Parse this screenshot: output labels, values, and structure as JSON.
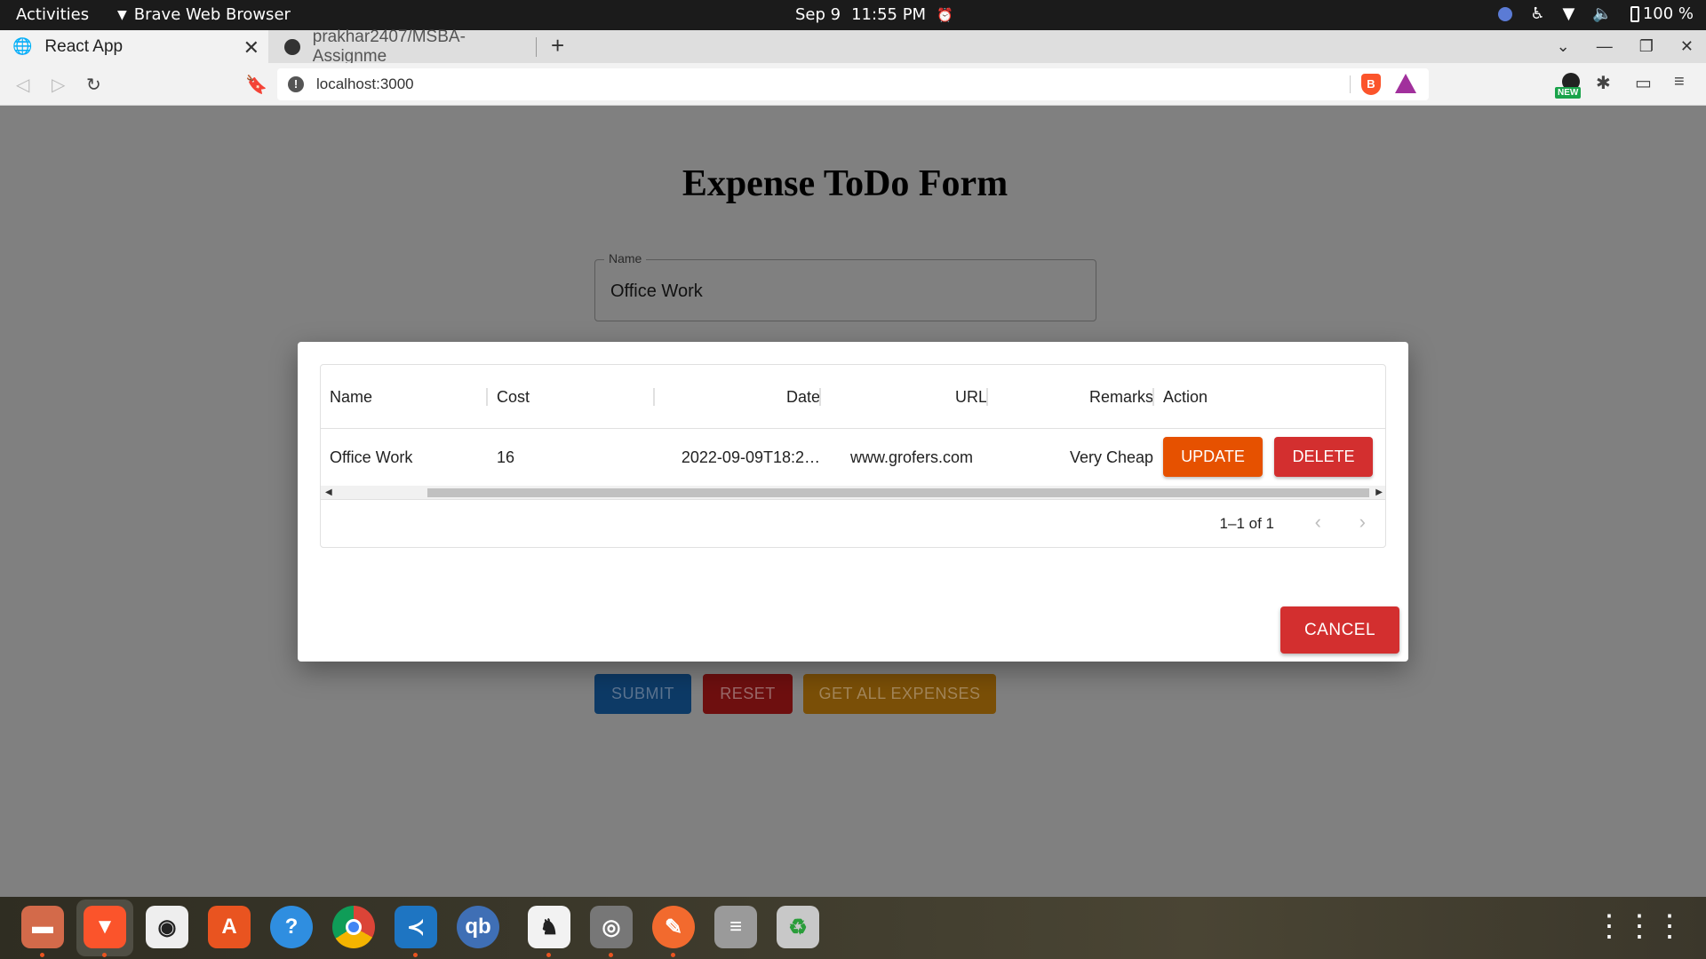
{
  "system_bar": {
    "activities": "Activities",
    "app_name": "Brave Web Browser",
    "date": "Sep 9",
    "time": "11:55 PM",
    "battery": "100 %"
  },
  "browser": {
    "tabs": [
      {
        "title": "React App",
        "active": true
      },
      {
        "title": "prakhar2407/MSBA-Assignme",
        "active": false
      }
    ],
    "url": "localhost:3000",
    "new_badge": "NEW"
  },
  "page": {
    "title": "Expense ToDo Form",
    "name_field": {
      "label": "Name",
      "value": "Office Work"
    },
    "buttons": {
      "submit": "SUBMIT",
      "reset": "RESET",
      "get_all": "GET ALL EXPENSES"
    }
  },
  "modal": {
    "columns": [
      "Name",
      "Cost",
      "Date",
      "URL",
      "Remarks",
      "Action"
    ],
    "rows": [
      {
        "name": "Office Work",
        "cost": "16",
        "date": "2022-09-09T18:2…",
        "url": "www.grofers.com",
        "remarks": "Very Cheap"
      }
    ],
    "update_label": "UPDATE",
    "delete_label": "DELETE",
    "pagination": "1–1 of 1",
    "cancel_label": "CANCEL"
  },
  "colors": {
    "update": "#e65100",
    "delete": "#d32f2f",
    "cancel": "#d32f2f",
    "backdrop": "#808080"
  }
}
